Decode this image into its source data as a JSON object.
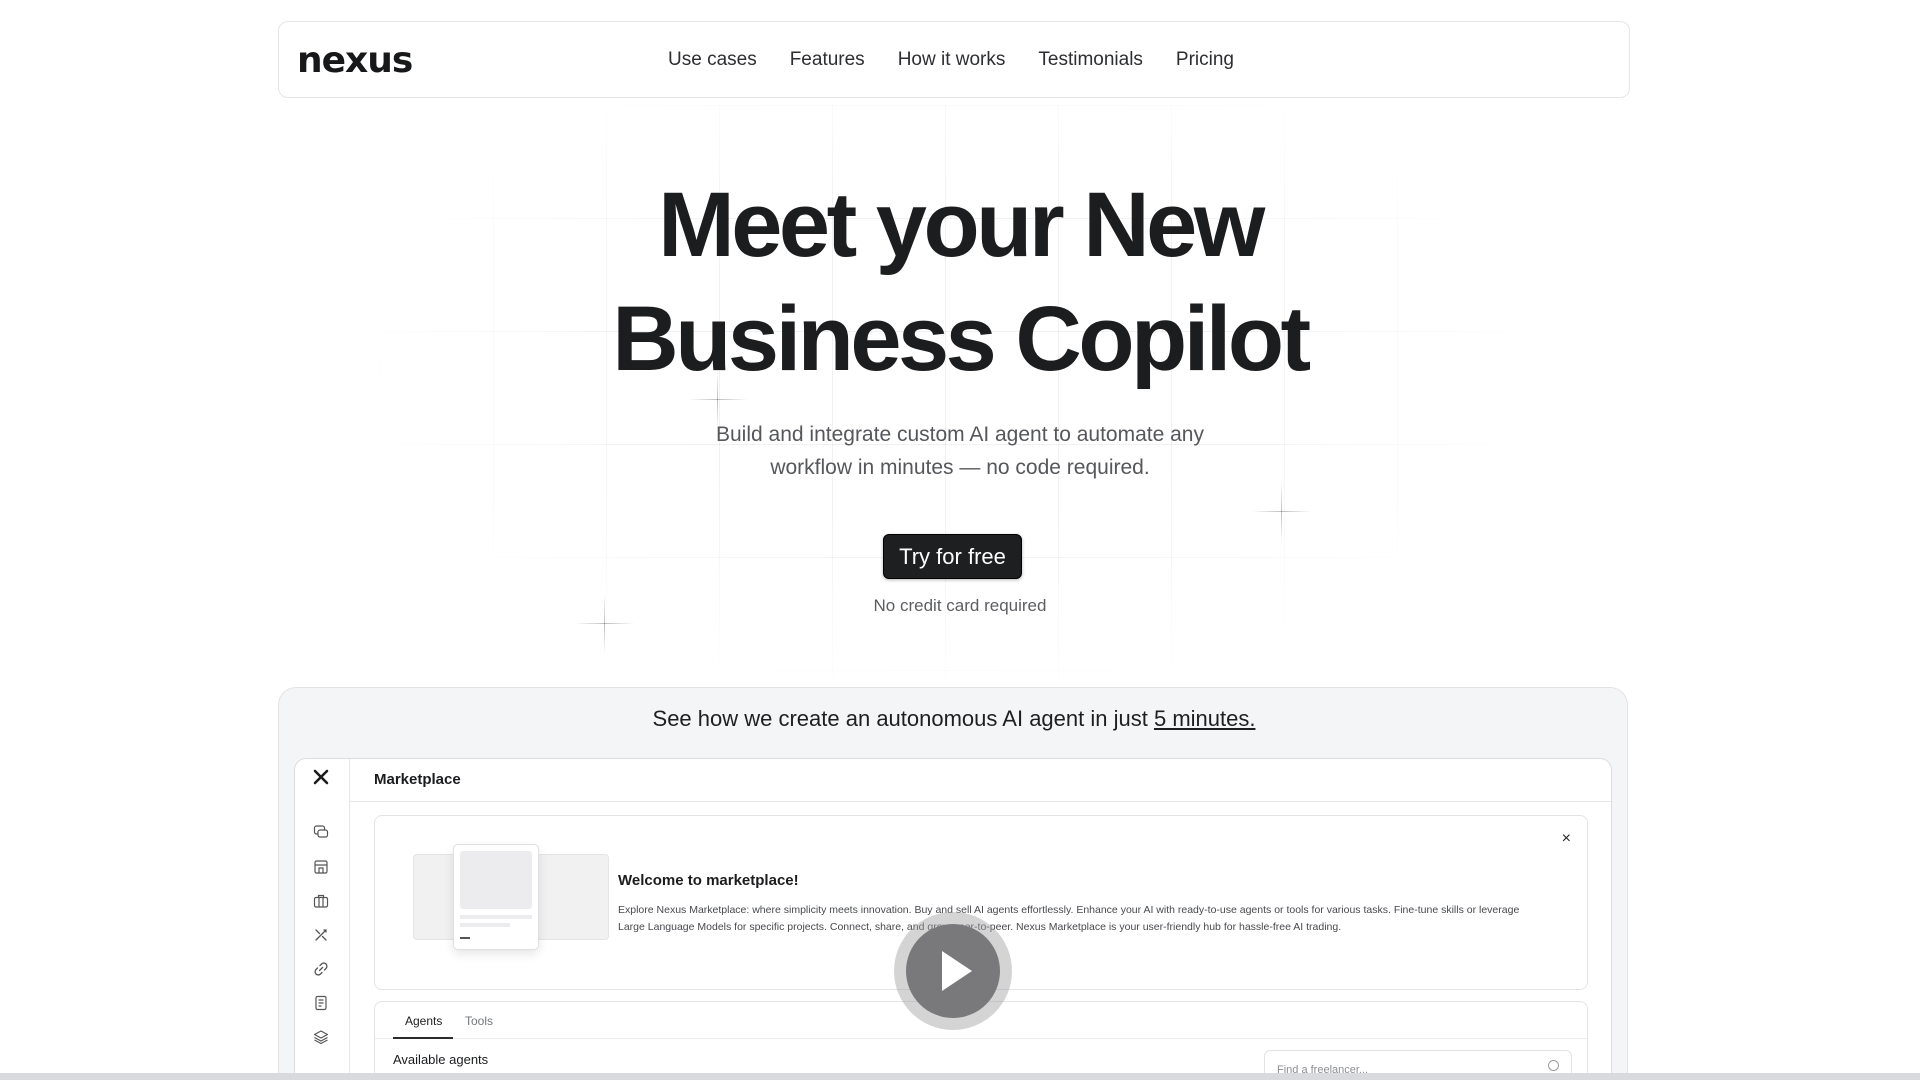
{
  "header": {
    "logo": "nexus",
    "nav": [
      "Use cases",
      "Features",
      "How it works",
      "Testimonials",
      "Pricing"
    ]
  },
  "hero": {
    "title_line1": "Meet your New",
    "title_line2": "Business Copilot",
    "subtitle_line1": "Build and integrate custom AI agent to automate any",
    "subtitle_line2": "workflow in minutes — no code required.",
    "cta": "Try for free",
    "note": "No credit card required"
  },
  "demo": {
    "caption_prefix": "See how we create an autonomous AI agent in just",
    "caption_link": "5 minutes.",
    "app": {
      "side_logo": "X",
      "title": "Marketplace",
      "sidebar_icons": [
        "chat-icon",
        "store-icon",
        "briefcase-icon",
        "tools-icon",
        "link-icon",
        "document-icon",
        "layers-icon"
      ],
      "welcome": {
        "title": "Welcome to marketplace!",
        "text": "Explore Nexus Marketplace: where simplicity meets innovation. Buy and sell AI agents effortlessly. Enhance your AI with ready-to-use agents or tools for various tasks. Fine-tune skills or leverage Large Language Models for specific projects. Connect, share, and grow peer-to-peer. Nexus Marketplace is your user-friendly hub for hassle-free AI trading.",
        "close": "×"
      },
      "tabs": [
        "Agents",
        "Tools"
      ],
      "available_label": "Available agents",
      "search_placeholder": "Find a freelancer..."
    }
  },
  "colors": {
    "cta_bg": "#1e1f21",
    "demo_bg": "#f4f5f6",
    "play": "#79797b"
  }
}
